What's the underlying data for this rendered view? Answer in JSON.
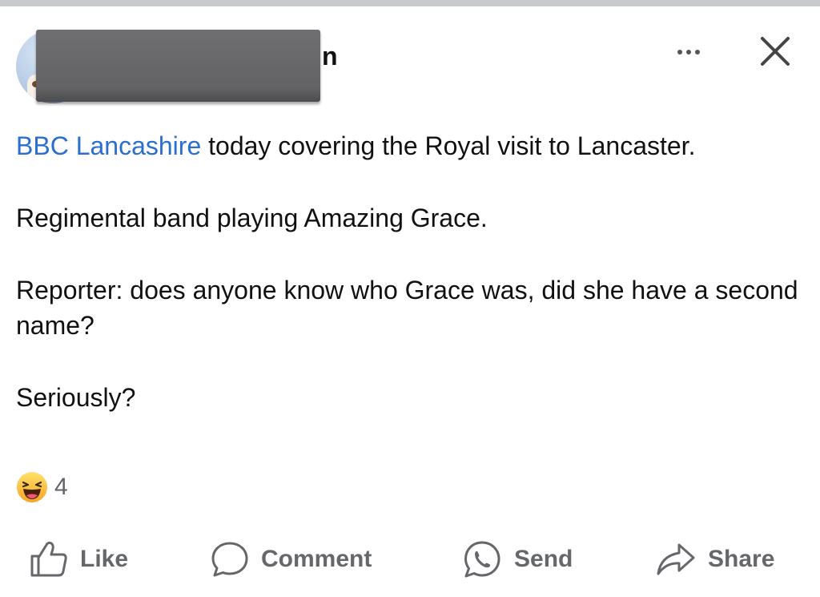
{
  "post": {
    "author_visible_fragment": "n",
    "mention": "BBC Lancashire",
    "paragraphs": [
      " today covering the Royal visit to Lancaster.",
      "Regimental band playing Amazing Grace.",
      "Reporter: does anyone know who Grace was, did she have a second name?",
      "Seriously?"
    ],
    "reaction_count": "4",
    "reaction_type": "haha-emoji-icon"
  },
  "actions": {
    "like": "Like",
    "comment": "Comment",
    "send": "Send",
    "share": "Share"
  },
  "icons": {
    "more": "more-horizontal-icon",
    "close": "close-icon"
  },
  "colors": {
    "mention_link": "#2a6ecf",
    "action_text": "#65676b",
    "redaction": "#636366"
  }
}
